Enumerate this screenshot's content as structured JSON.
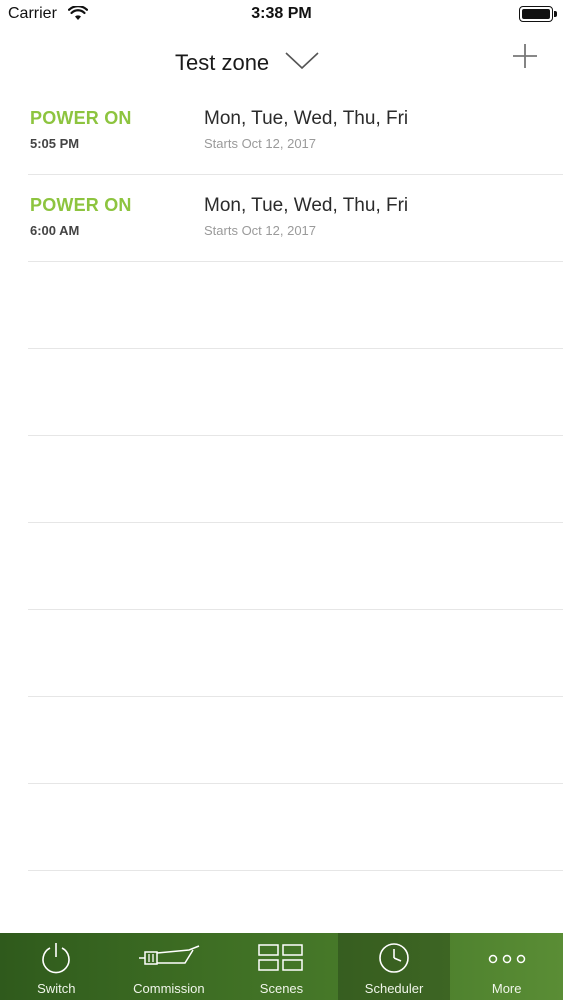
{
  "status_bar": {
    "carrier": "Carrier",
    "time": "3:38 PM"
  },
  "header": {
    "zone_title": "Test zone",
    "dropdown_icon": "chevron-down-icon",
    "add_icon": "plus-icon"
  },
  "schedules": [
    {
      "action": "POWER ON",
      "time": "5:05 PM",
      "days": "Mon, Tue, Wed, Thu, Fri",
      "starts": "Starts Oct 12, 2017"
    },
    {
      "action": "POWER ON",
      "time": "6:00 AM",
      "days": "Mon, Tue, Wed, Thu, Fri",
      "starts": "Starts Oct 12, 2017"
    }
  ],
  "tabs": [
    {
      "label": "Switch",
      "icon": "power-icon"
    },
    {
      "label": "Commission",
      "icon": "commission-icon"
    },
    {
      "label": "Scenes",
      "icon": "scenes-grid-icon"
    },
    {
      "label": "Scheduler",
      "icon": "clock-icon",
      "active": true
    },
    {
      "label": "More",
      "icon": "more-dots-icon"
    }
  ],
  "colors": {
    "accent_green": "#8dc43f",
    "tabbar_dark": "#2f5a1c",
    "tabbar_light": "#5a8d35"
  }
}
